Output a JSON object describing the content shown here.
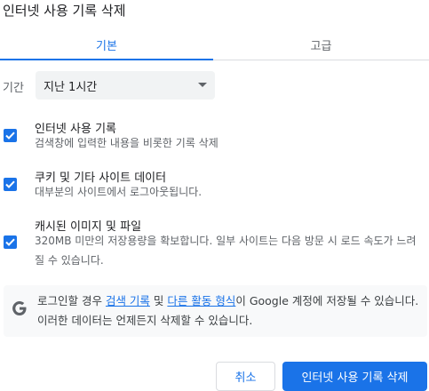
{
  "dialog": {
    "title": "인터넷 사용 기록 삭제"
  },
  "tabs": [
    {
      "label": "기본",
      "active": true
    },
    {
      "label": "고급",
      "active": false
    }
  ],
  "time_range": {
    "label": "기간",
    "selected": "지난 1시간"
  },
  "options": [
    {
      "title": "인터넷 사용 기록",
      "desc": "검색창에 입력한 내용을 비롯한 기록 삭제",
      "checked": true
    },
    {
      "title": "쿠키 및 기타 사이트 데이터",
      "desc": "대부분의 사이트에서 로그아웃됩니다.",
      "checked": true
    },
    {
      "title": "캐시된 이미지 및 파일",
      "desc": "320MB 미만의 저장용량을 확보합니다. 일부 사이트는 다음 방문 시 로드 속도가 느려질 수 있습니다.",
      "checked": true
    }
  ],
  "google_notice": {
    "icon": "google-g-icon",
    "prefix": "로그인할 경우 ",
    "link1": "검색 기록",
    "mid": " 및 ",
    "link2": "다른 활동 형식",
    "suffix": "이 Google 계정에 저장될 수 있습니다. 이러한 데이터는 언제든지 삭제할 수 있습니다."
  },
  "buttons": {
    "cancel": "취소",
    "delete": "인터넷 사용 기록 삭제"
  },
  "colors": {
    "accent": "#1a73e8",
    "text": "#202124",
    "secondary_text": "#5f6368",
    "notice_bg": "#f8f9fa"
  }
}
